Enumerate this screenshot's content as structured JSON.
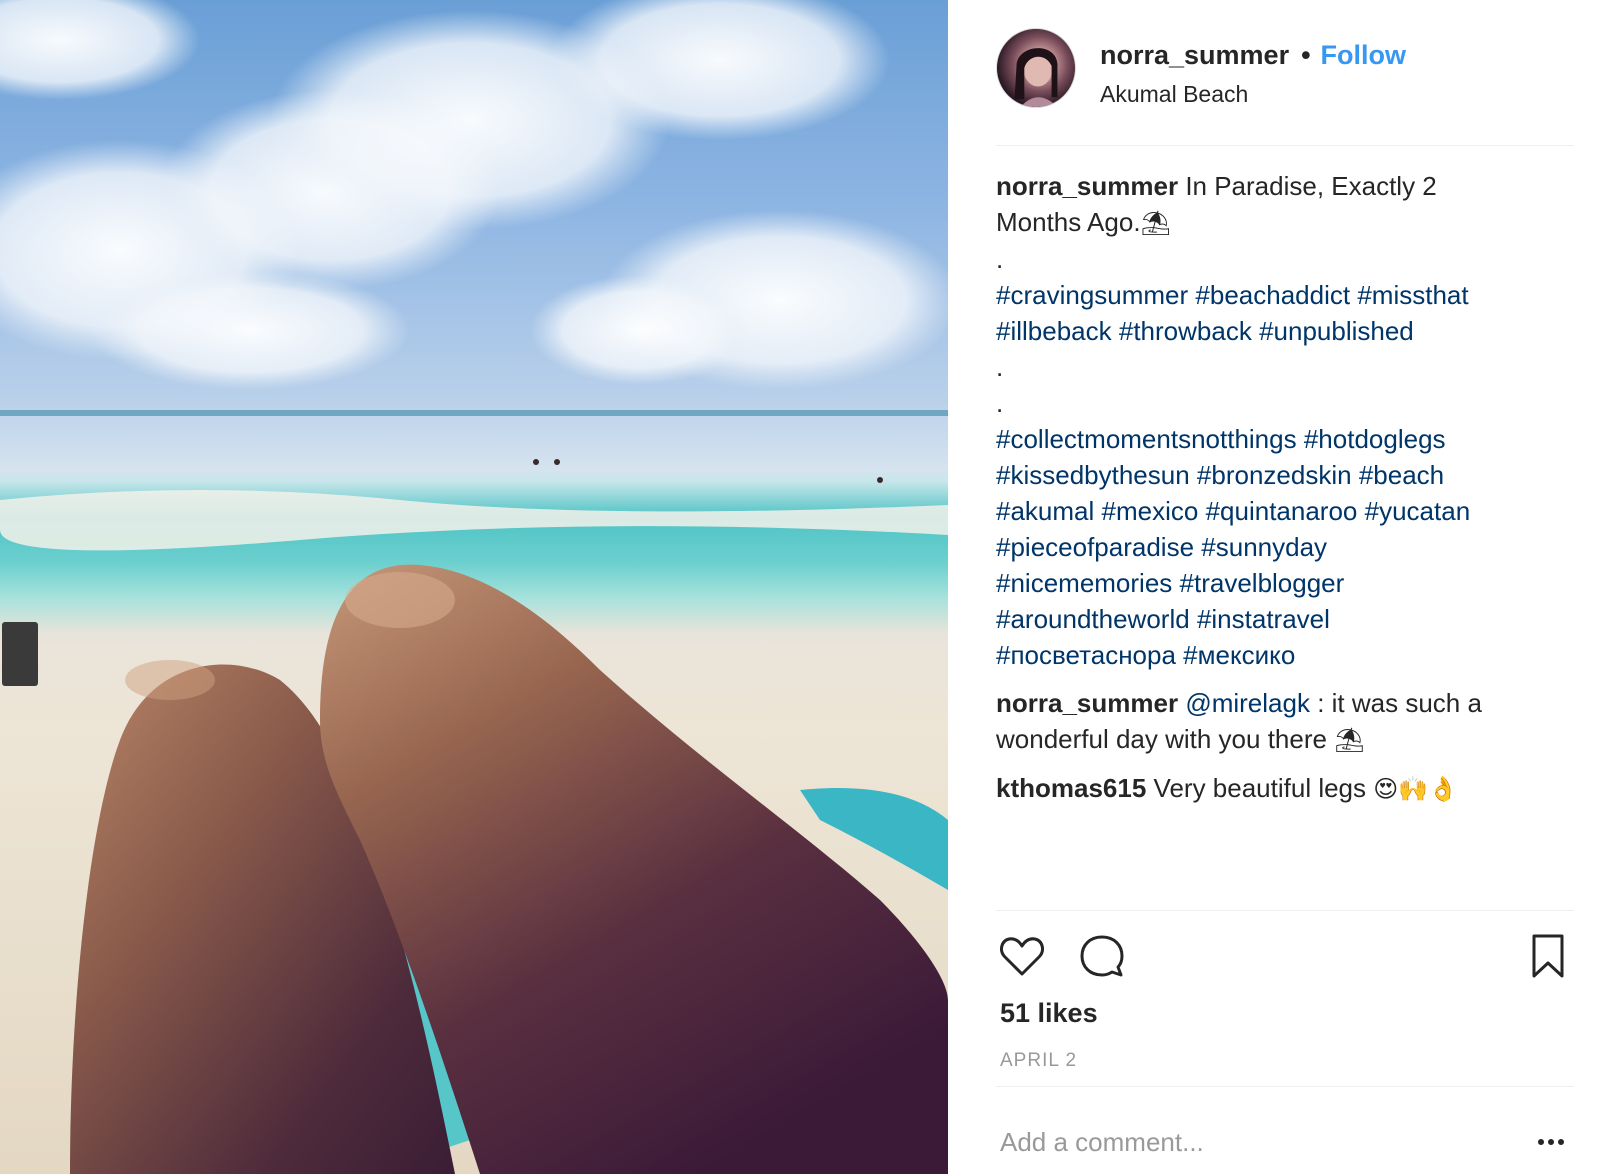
{
  "post": {
    "username": "norra_summer",
    "separator": "•",
    "follow_label": "Follow",
    "location": "Akumal Beach"
  },
  "caption": {
    "user": "norra_summer",
    "text_line1": "In Paradise, Exactly 2",
    "text_line2": "Months Ago.",
    "emoji": "⛱",
    "dot1": ".",
    "tags_row1": [
      "#cravingsummer",
      "#beachaddict",
      "#missthat"
    ],
    "tags_row2": [
      "#illbeback",
      "#throwback",
      "#unpublished"
    ],
    "dot2": ".",
    "dot3": ".",
    "tags_row3": [
      "#collectmomentsnotthings",
      "#hotdoglegs"
    ],
    "tags_row4": [
      "#kissedbythesun",
      "#bronzedskin",
      "#beach"
    ],
    "tags_row5": [
      "#akumal",
      "#mexico",
      "#quintanaroo",
      "#yucatan"
    ],
    "tags_row6": [
      "#pieceofparadise",
      "#sunnyday"
    ],
    "tags_row7": [
      "#nicememories",
      "#travelblogger"
    ],
    "tags_row8": [
      "#aroundtheworld",
      "#instatravel"
    ],
    "tags_row9": [
      "#посветаснора",
      "#мексико"
    ]
  },
  "comments": [
    {
      "user": "norra_summer",
      "mention": "@mirelagk",
      "text_a": ": it was such a",
      "text_b": "wonderful day with you there",
      "emoji": "⛱"
    },
    {
      "user": "kthomas615",
      "text": "Very beautiful legs",
      "emoji": "😍🙌👌"
    }
  ],
  "actions": {
    "like_icon": "heart-icon",
    "comment_icon": "speech-bubble-icon",
    "save_icon": "bookmark-icon"
  },
  "likes_label": "51 likes",
  "date_label": "APRIL 2",
  "add_comment_placeholder": "Add a comment...",
  "more_icon": "more-options-icon",
  "colors": {
    "link_blue": "#3897f0",
    "hashtag": "#003569",
    "text": "#262626",
    "muted": "#999999",
    "divider": "#efefef"
  }
}
